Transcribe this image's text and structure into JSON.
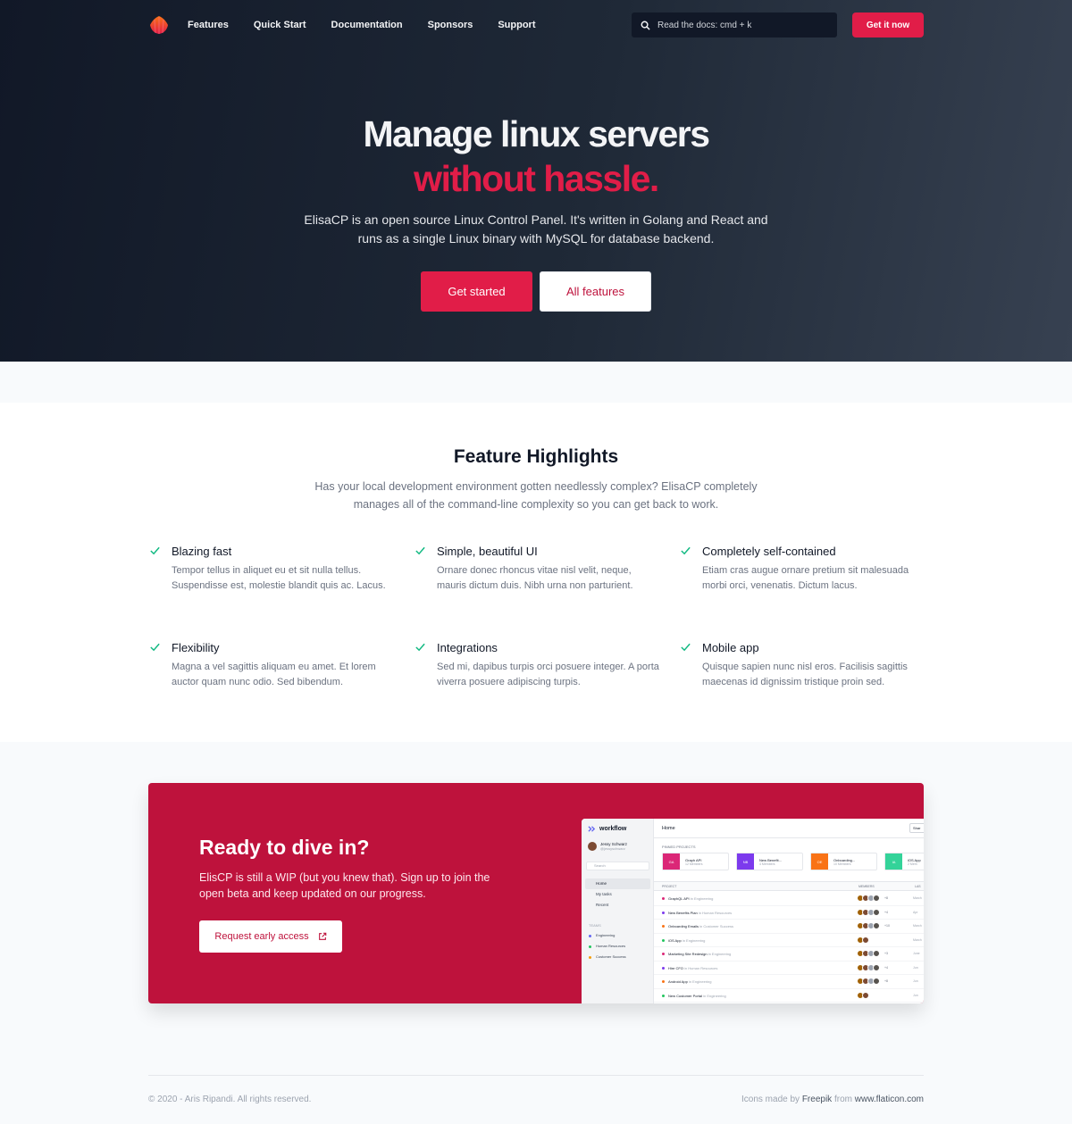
{
  "nav": {
    "links": [
      "Features",
      "Quick Start",
      "Documentation",
      "Sponsors",
      "Support"
    ],
    "search_placeholder": "Read the docs: cmd + k",
    "cta_label": "Get it now"
  },
  "hero": {
    "title_line1": "Manage linux servers",
    "title_line2": "without hassle.",
    "subtitle": "ElisaCP is an open source Linux Control Panel. It's written in Golang and React and runs as a single Linux binary with MySQL for database backend.",
    "primary_button": "Get started",
    "secondary_button": "All features"
  },
  "features": {
    "title": "Feature Highlights",
    "subtitle": "Has your local development environment gotten needlessly complex? ElisaCP completely manages all of the command-line complexity so you can get back to work.",
    "items": [
      {
        "name": "Blazing fast",
        "desc": "Tempor tellus in aliquet eu et sit nulla tellus. Suspendisse est, molestie blandit quis ac. Lacus."
      },
      {
        "name": "Simple, beautiful UI",
        "desc": "Ornare donec rhoncus vitae nisl velit, neque, mauris dictum duis. Nibh urna non parturient."
      },
      {
        "name": "Completely self-contained",
        "desc": "Etiam cras augue ornare pretium sit malesuada morbi orci, venenatis. Dictum lacus."
      },
      {
        "name": "Flexibility",
        "desc": "Magna a vel sagittis aliquam eu amet. Et lorem auctor quam nunc odio. Sed bibendum."
      },
      {
        "name": "Integrations",
        "desc": "Sed mi, dapibus turpis orci posuere integer. A porta viverra posuere adipiscing turpis."
      },
      {
        "name": "Mobile app",
        "desc": "Quisque sapien nunc nisl eros. Facilisis sagittis maecenas id dignissim tristique proin sed."
      }
    ]
  },
  "cta": {
    "title": "Ready to dive in?",
    "subtitle": "ElisCP is still a WIP (but you knew that). Sign up to join the open beta and keep updated on our progress.",
    "button": "Request early access"
  },
  "mock": {
    "brand": "workflow",
    "user_name": "Jessy Schwarz",
    "user_handle": "@jessyschwarz",
    "search": "Search",
    "nav": [
      "Home",
      "My tasks",
      "Recent"
    ],
    "teams_label": "TEAMS",
    "teams": [
      {
        "name": "Engineering",
        "color": "#6366f1"
      },
      {
        "name": "Human Resources",
        "color": "#22c55e"
      },
      {
        "name": "Customer Success",
        "color": "#f59e0b"
      }
    ],
    "header": "Home",
    "share": "Shar",
    "pinned_label": "PINNED PROJECTS",
    "pinned": [
      {
        "abbr": "GA",
        "name": "Graph API",
        "members": "12 Members",
        "color": "#db2777"
      },
      {
        "abbr": "NB",
        "name": "New Benefit...",
        "members": "4 Members",
        "color": "#7c3aed"
      },
      {
        "abbr": "OE",
        "name": "Onboarding...",
        "members": "10 Members",
        "color": "#f97316"
      },
      {
        "abbr": "IA",
        "name": "iOS App",
        "members": "2 Mem",
        "color": "#34d399"
      }
    ],
    "columns": {
      "project": "PROJECT",
      "members": "MEMBERS",
      "last": "LAS"
    },
    "rows": [
      {
        "name": "GraphQL API",
        "team": "in Engineering",
        "color": "#db2777",
        "extra": "+8",
        "last": "March"
      },
      {
        "name": "New Benefits Plan",
        "team": "in Human Resources",
        "color": "#7c3aed",
        "extra": "+4",
        "last": "Apr"
      },
      {
        "name": "Onboarding Emails",
        "team": "in Customer Success",
        "color": "#f97316",
        "extra": "+10",
        "last": "March"
      },
      {
        "name": "iOS App",
        "team": "in Engineering",
        "color": "#22c55e",
        "extra": "",
        "last": "March"
      },
      {
        "name": "Marketing Site Redesign",
        "team": "in Engineering",
        "color": "#db2777",
        "extra": "+3",
        "last": "June"
      },
      {
        "name": "Hire CFO",
        "team": "in Human Resources",
        "color": "#7c3aed",
        "extra": "+4",
        "last": "Jun"
      },
      {
        "name": "Android App",
        "team": "in Engineering",
        "color": "#f97316",
        "extra": "+8",
        "last": "Jun"
      },
      {
        "name": "New Customer Portal",
        "team": "in Engineering",
        "color": "#22c55e",
        "extra": "",
        "last": "Jun"
      }
    ]
  },
  "footer": {
    "copyright": "© 2020 - Aris Ripandi. All rights reserved.",
    "icons_prefix": "Icons made by",
    "freepik": "Freepik",
    "from": "from",
    "flaticon": "www.flaticon.com"
  },
  "colors": {
    "accent": "#e11d48",
    "cta_bg": "#be123c",
    "check": "#10b981",
    "hero_bg": "#111827"
  }
}
